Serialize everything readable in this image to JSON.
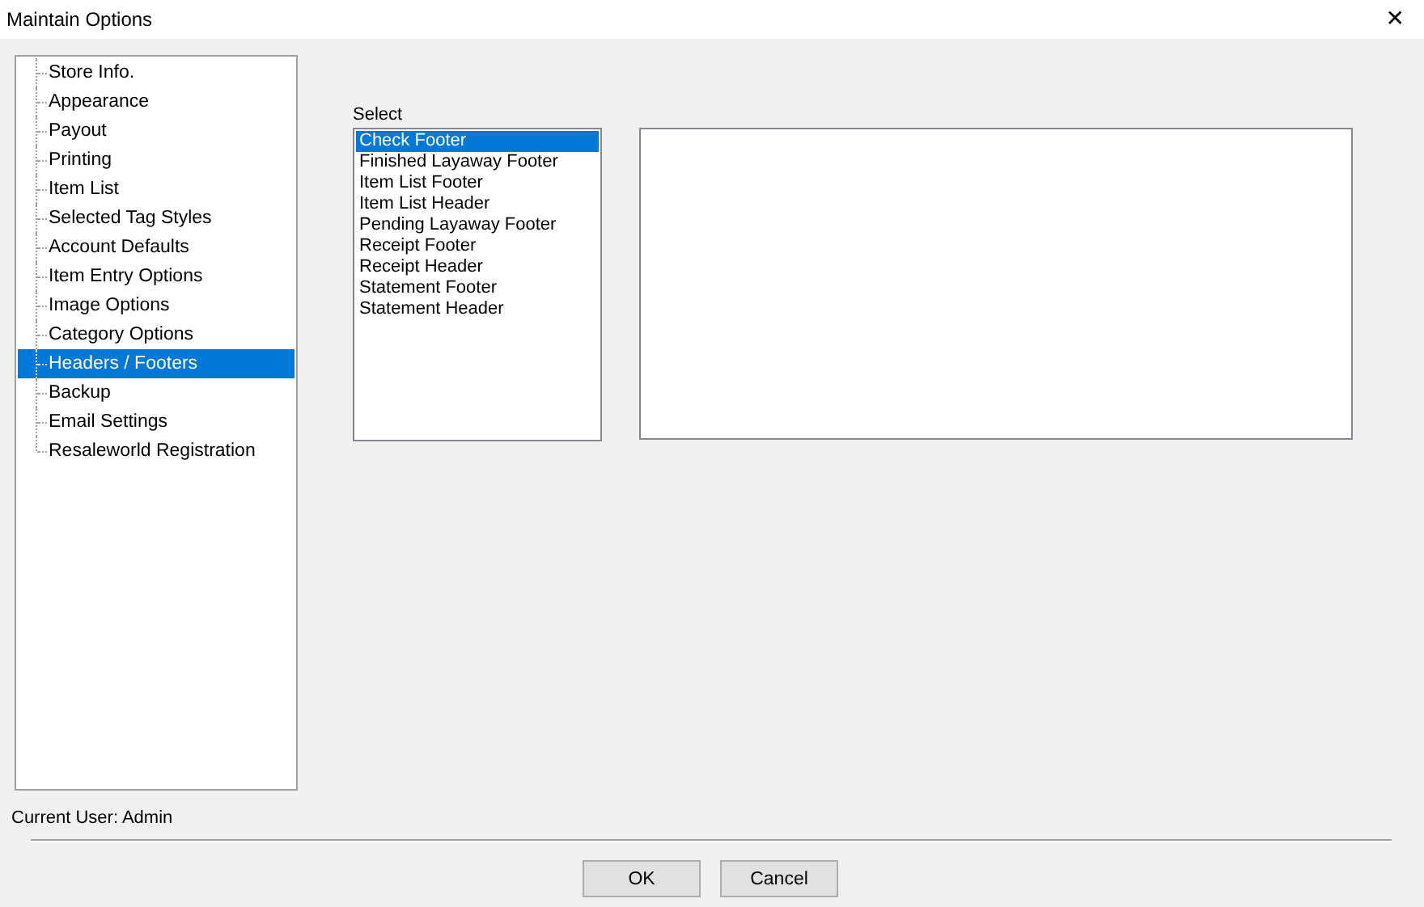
{
  "window": {
    "title": "Maintain Options",
    "close": "✕"
  },
  "tree": {
    "items": [
      {
        "label": "Store Info.",
        "selected": false
      },
      {
        "label": "Appearance",
        "selected": false
      },
      {
        "label": "Payout",
        "selected": false
      },
      {
        "label": "Printing",
        "selected": false
      },
      {
        "label": "Item List",
        "selected": false
      },
      {
        "label": "Selected Tag Styles",
        "selected": false
      },
      {
        "label": "Account Defaults",
        "selected": false
      },
      {
        "label": "Item Entry Options",
        "selected": false
      },
      {
        "label": "Image Options",
        "selected": false
      },
      {
        "label": "Category Options",
        "selected": false
      },
      {
        "label": "Headers / Footers",
        "selected": true
      },
      {
        "label": "Backup",
        "selected": false
      },
      {
        "label": "Email Settings",
        "selected": false
      },
      {
        "label": "Resaleworld Registration",
        "selected": false
      }
    ]
  },
  "select": {
    "label": "Select",
    "items": [
      {
        "label": "Check Footer",
        "selected": true
      },
      {
        "label": "Finished Layaway Footer",
        "selected": false
      },
      {
        "label": "Item List Footer",
        "selected": false
      },
      {
        "label": "Item List Header",
        "selected": false
      },
      {
        "label": "Pending Layaway Footer",
        "selected": false
      },
      {
        "label": "Receipt Footer",
        "selected": false
      },
      {
        "label": "Receipt Header",
        "selected": false
      },
      {
        "label": "Statement Footer",
        "selected": false
      },
      {
        "label": "Statement Header",
        "selected": false
      }
    ]
  },
  "status": {
    "current_user": "Current User: Admin"
  },
  "buttons": [
    "OK",
    "Cancel"
  ]
}
